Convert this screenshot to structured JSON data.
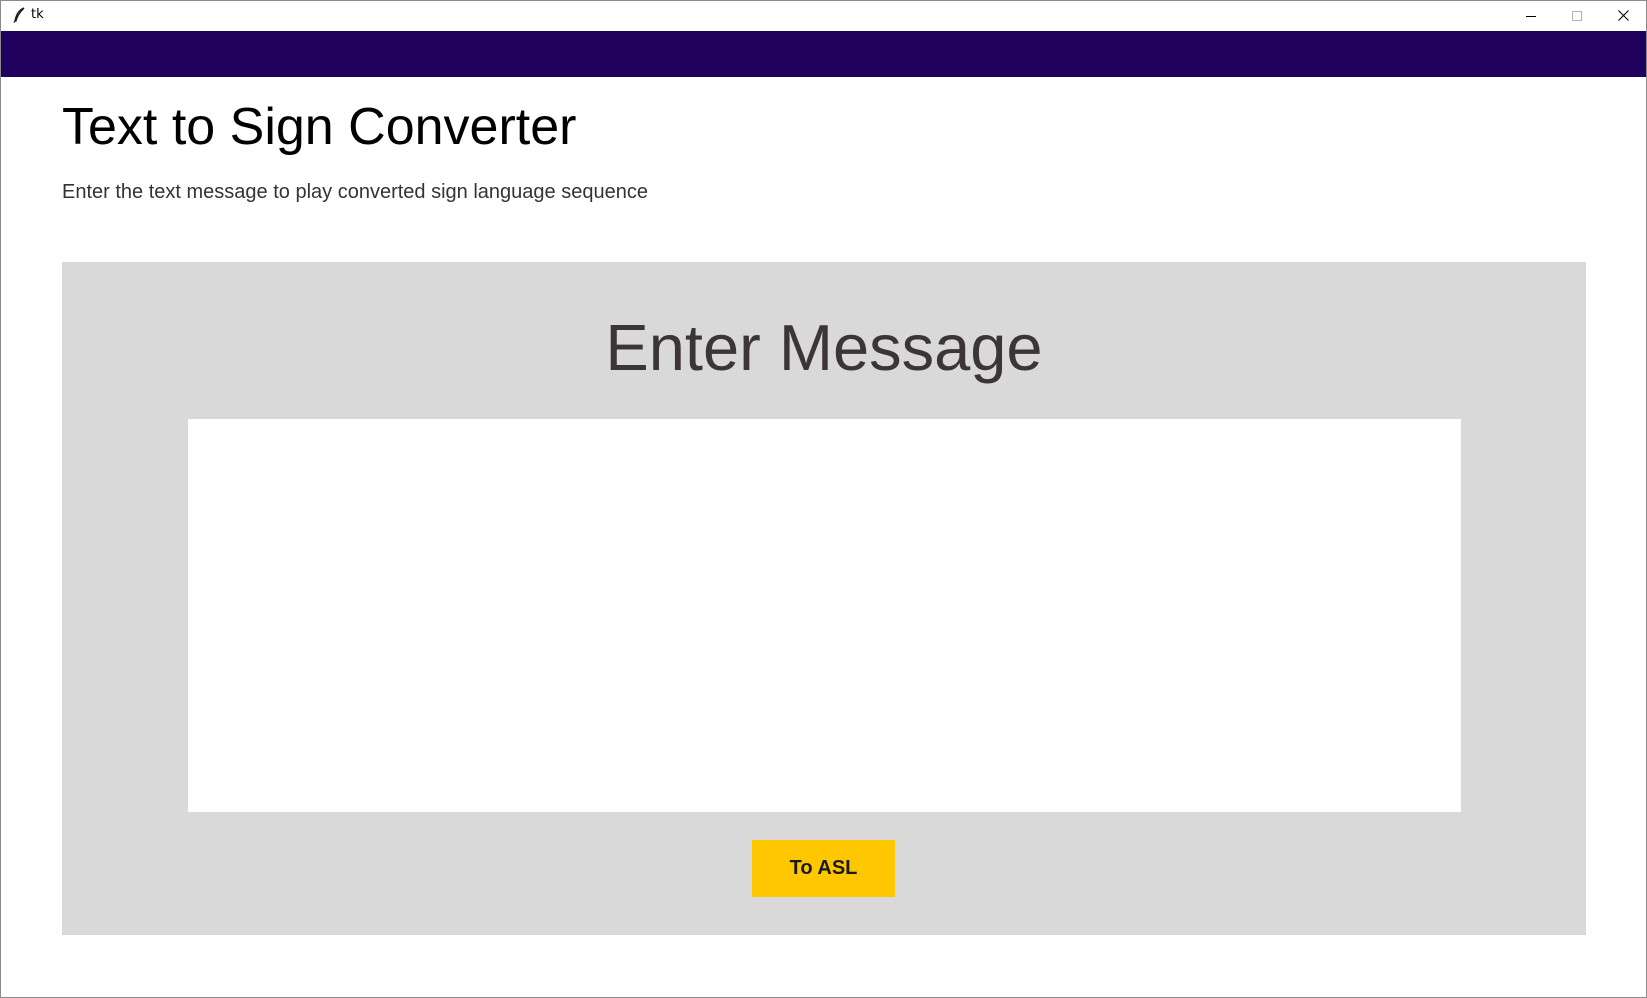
{
  "window": {
    "title": "tk",
    "icon": "feather-icon"
  },
  "colors": {
    "header_band": "#1f005c",
    "panel_bg": "#d9d9d9",
    "button_bg": "#ffc700"
  },
  "header": {
    "title": "Text to Sign Converter",
    "subtitle": "Enter the text message to play converted sign language sequence"
  },
  "panel": {
    "heading": "Enter Message",
    "input_value": "",
    "button_label": "To ASL"
  }
}
